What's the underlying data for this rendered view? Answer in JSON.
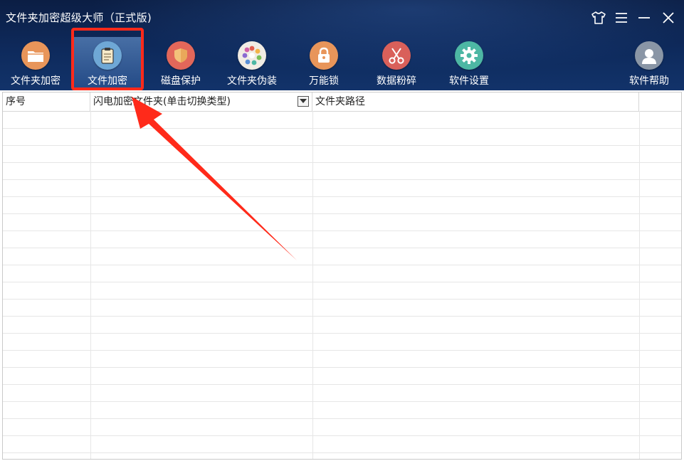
{
  "app": {
    "title": "文件夹加密超级大师（正式版)"
  },
  "toolbar": {
    "items": [
      {
        "label": "文件夹加密",
        "icon": "folder-icon",
        "color": "#e8955a"
      },
      {
        "label": "文件加密",
        "icon": "clipboard-document-icon",
        "color": "#6fa8d6"
      },
      {
        "label": "磁盘保护",
        "icon": "shield-icon",
        "color": "#e2675a"
      },
      {
        "label": "文件夹伪装",
        "icon": "color-wheel-icon",
        "color": "#f1ece4"
      },
      {
        "label": "万能锁",
        "icon": "padlock-icon",
        "color": "#e8955a"
      },
      {
        "label": "数据粉碎",
        "icon": "scissors-icon",
        "color": "#d9605a"
      },
      {
        "label": "软件设置",
        "icon": "gear-icon",
        "color": "#4db7a4"
      },
      {
        "label": "软件帮助",
        "icon": "user-avatar-icon",
        "color": "#8a96a6"
      }
    ],
    "active_index": 1,
    "highlight_color": "#ff2a1a"
  },
  "table": {
    "columns": [
      "序号",
      "闪电加密文件夹(单击切换类型)",
      "文件夹路径",
      ""
    ],
    "rows": []
  }
}
